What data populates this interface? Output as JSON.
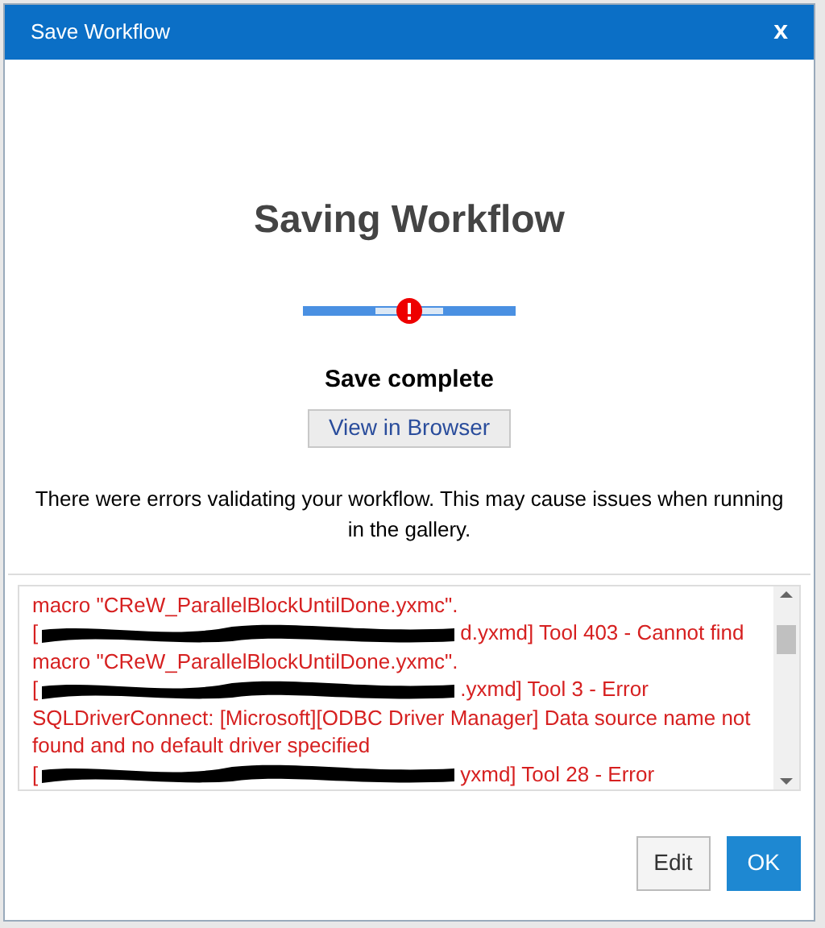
{
  "window": {
    "title": "Save Workflow",
    "close": "x"
  },
  "heading": "Saving Workflow",
  "progress": {
    "error": true,
    "segments": [
      {
        "done": true
      },
      {
        "done": false
      },
      {
        "done": true
      }
    ]
  },
  "status": "Save complete",
  "view_button": "View in Browser",
  "message": "There were errors validating your workflow. This may cause issues when running in the gallery.",
  "errors": [
    {
      "parts": [
        {
          "kind": "text",
          "text": "macro \"CReW_ParallelBlockUntilDone.yxmc\"."
        }
      ]
    },
    {
      "parts": [
        {
          "kind": "text",
          "text": "["
        },
        {
          "kind": "redacted"
        },
        {
          "kind": "text",
          "text": "d.yxmd] Tool 403 - Cannot find"
        }
      ]
    },
    {
      "parts": [
        {
          "kind": "text",
          "text": "macro \"CReW_ParallelBlockUntilDone.yxmc\"."
        }
      ]
    },
    {
      "parts": [
        {
          "kind": "text",
          "text": "["
        },
        {
          "kind": "redacted"
        },
        {
          "kind": "text",
          "text": ".yxmd] Tool 3 - Error"
        }
      ]
    },
    {
      "parts": [
        {
          "kind": "text",
          "text": "SQLDriverConnect: [Microsoft][ODBC Driver Manager] Data source name not"
        }
      ]
    },
    {
      "parts": [
        {
          "kind": "text",
          "text": "found and no default driver specified"
        }
      ]
    },
    {
      "parts": [
        {
          "kind": "text",
          "text": "["
        },
        {
          "kind": "redacted"
        },
        {
          "kind": "text",
          "text": "yxmd] Tool 28 - Error"
        }
      ]
    }
  ],
  "buttons": [
    {
      "label": "Edit",
      "primary": false
    },
    {
      "label": "OK",
      "primary": true
    }
  ]
}
